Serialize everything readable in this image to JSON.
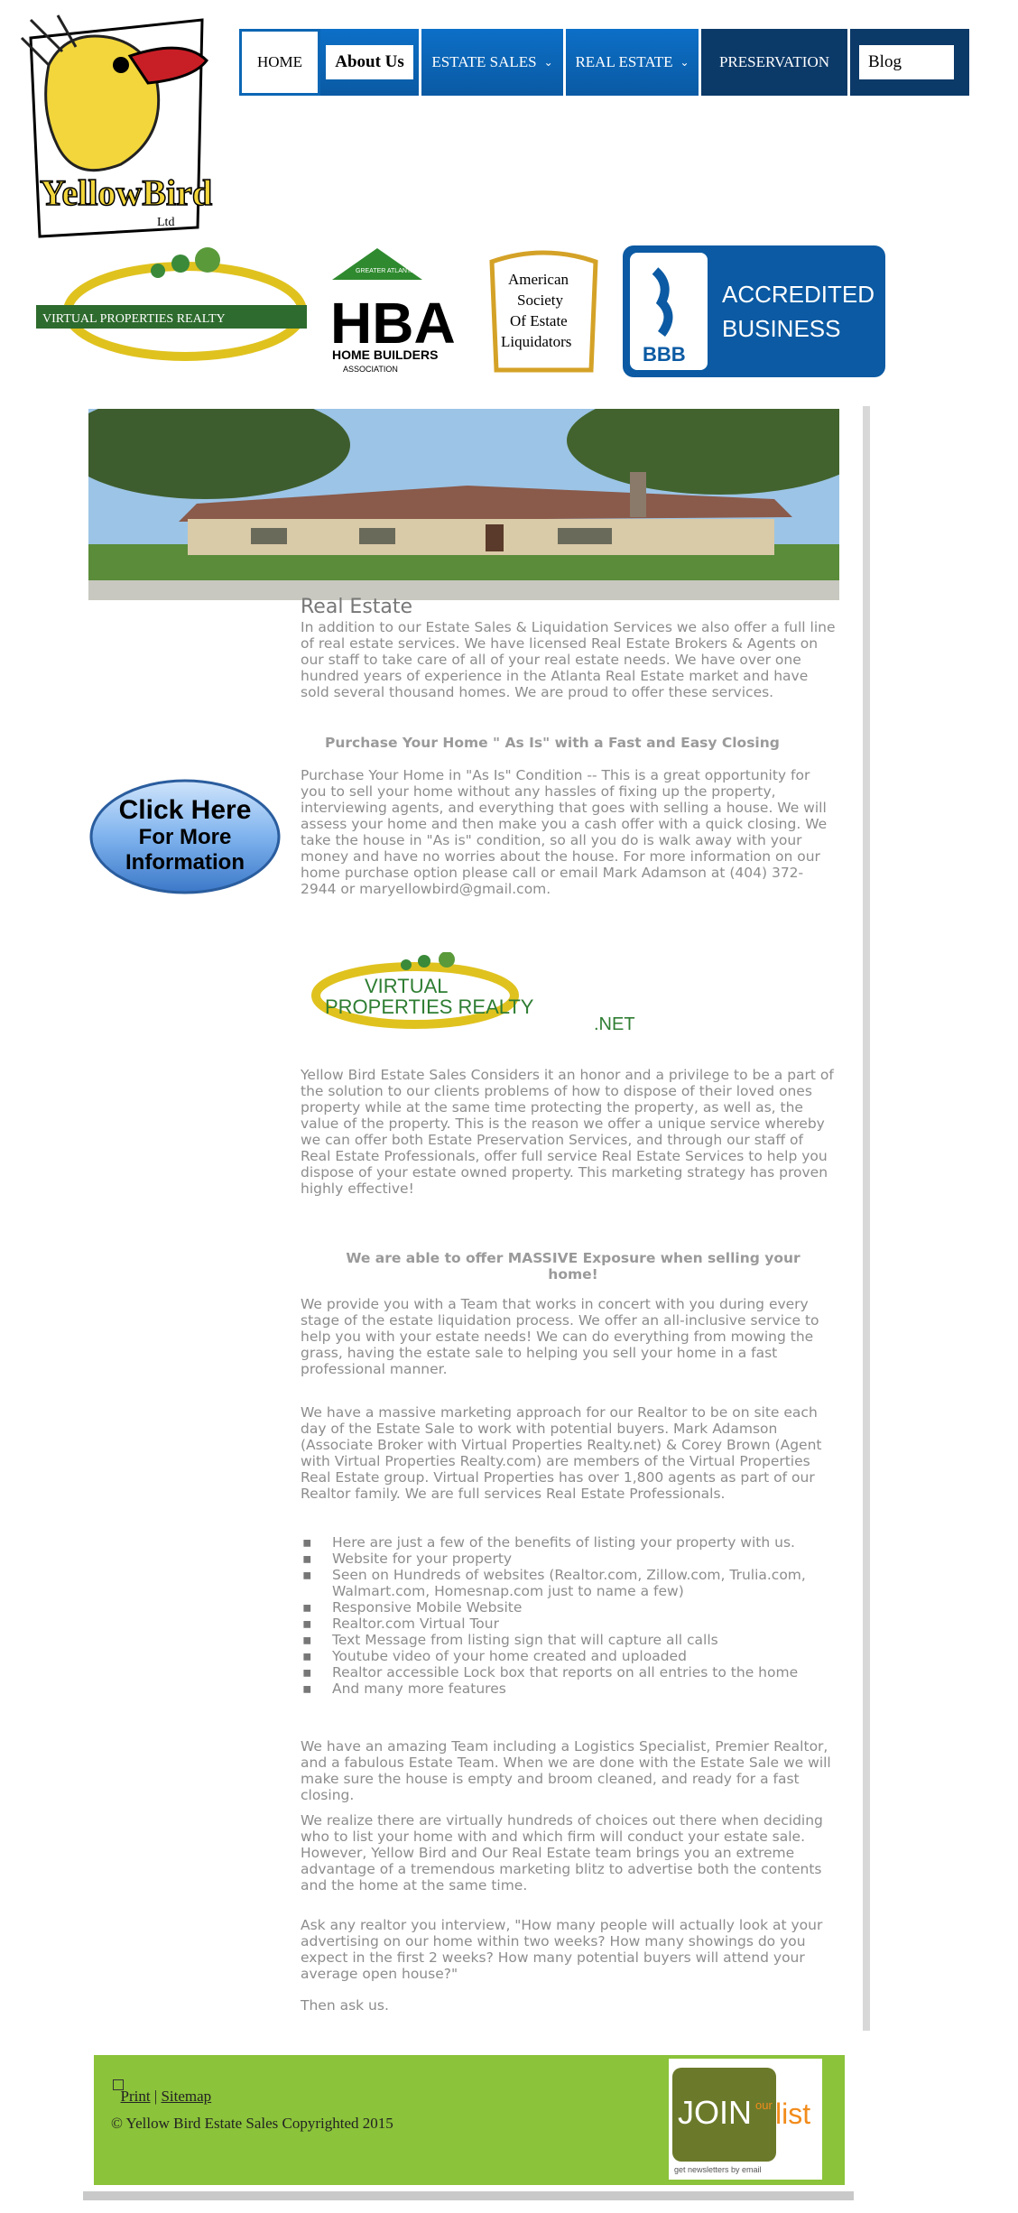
{
  "nav": {
    "items": [
      {
        "label": "HOME"
      },
      {
        "label": "About Us"
      },
      {
        "label": "ESTATE SALES"
      },
      {
        "label": "REAL ESTATE"
      },
      {
        "label": "PRESERVATION"
      },
      {
        "label": "Blog"
      }
    ]
  },
  "logo": {
    "text_main": "YellowBird",
    "text_small": "Ltd"
  },
  "badges": {
    "vpr_small": "VIRTUAL PROPERTIES REALTY",
    "hba_letters": "HBA",
    "hba_line1": "HOME BUILDERS",
    "hba_line2": "ASSOCIATION",
    "hba_top": "GREATER ATLANTA",
    "asel_line1": "American",
    "asel_line2": "Society",
    "asel_line3": "Of Estate",
    "asel_line4": "Liquidators",
    "bbb_line1": "ACCREDITED",
    "bbb_line2": "BUSINESS",
    "bbb_mark": "BBB"
  },
  "content": {
    "title": "Real Estate",
    "para1": "In addition to our Estate Sales & Liquidation Services we also offer a full line of real estate services. We have licensed Real Estate Brokers & Agents on our staff to take care of all of your real estate needs. We have over one hundred years of experience in the Atlanta Real Estate market and have sold several thousand homes. We are proud to offer these services.",
    "purchase_head": "Purchase Your Home \" As Is\" with a Fast and Easy Closing",
    "para2": "Purchase Your Home in \"As Is\" Condition -- This is a great opportunity for you to sell your home without any hassles of fixing up the property, interviewing agents, and everything that goes with selling a house. We will assess your home and then make you a cash offer with a quick closing. We take the house in \"As is\" condition, so all you do is walk away with your money and have no worries about the house. For more information on our home purchase option please call or email Mark Adamson at (404) 372-2944 or maryellowbird@gmail.com.",
    "cta_line1": "Click Here",
    "cta_line2": "For More",
    "cta_line3": "Information",
    "vpr_line1": "VIRTUAL",
    "vpr_line2": "PROPERTIES REALTY",
    "vpr_line3": ".NET",
    "para3": "Yellow Bird Estate Sales Considers it an honor and a privilege to be a part of the solution to our clients problems of how to dispose of their loved ones property while at the same time protecting the property, as well as, the value of the property. This is the reason we offer a unique service whereby we can offer both Estate Preservation Services, and through our staff of Real Estate Professionals, offer full service Real Estate Services to help you dispose of your estate owned property. This marketing strategy has proven highly effective!",
    "massive": "We are able to offer MASSIVE Exposure when selling your home!",
    "para4": "We provide you with a Team that works in concert with you during every stage of the estate liquidation process. We offer an all-inclusive service to help you with your estate needs! We can do everything from mowing the grass, having the estate sale to helping you sell your home in a fast professional manner.",
    "para5": "We have a massive marketing approach for our Realtor to be on site each day of the Estate Sale to work with potential buyers. Mark Adamson (Associate Broker with Virtual Properties Realty.net) & Corey Brown (Agent with Virtual Properties Realty.com) are members of the Virtual Properties Real Estate group. Virtual Properties has over 1,800 agents as part of our Realtor family. We are full services Real Estate Professionals.",
    "bullets": [
      "Here are just a few of the benefits of listing your property with us.",
      "Website for your property",
      "Seen on Hundreds of websites (Realtor.com, Zillow.com, Trulia.com, Walmart.com, Homesnap.com just to name a few)",
      "Responsive Mobile Website",
      "Realtor.com Virtual Tour",
      "Text Message from listing sign that will capture all calls",
      "Youtube video of your home created and uploaded",
      "Realtor accessible Lock box that reports on all entries to the home",
      "And many more features"
    ],
    "para6": "We have an amazing Team including a Logistics Specialist, Premier Realtor, and a fabulous Estate Team. When we are done with the Estate Sale we will make sure the house is empty and broom cleaned, and ready for a fast closing.",
    "para7": "We realize there are virtually hundreds of choices out there when deciding who to list your home with and which firm will conduct your estate sale. However, Yellow Bird and Our Real Estate team brings you an extreme advantage of a tremendous marketing blitz to advertise both the contents and the home at the same time.",
    "para8": "Ask any realtor you interview, \"How many people will actually look at your advertising on our home within two weeks? How many showings do you expect in the first 2 weeks? How many potential buyers will attend your average open house?\"",
    "then_ask": "Then ask us."
  },
  "footer": {
    "print": "Print",
    "sep": "|",
    "sitemap": "Sitemap",
    "copyright": "© Yellow Bird Estate Sales Copyrighted 2015",
    "join_word": "JOIN",
    "join_our": "our",
    "join_list": "list",
    "join_small": "get newsletters by email"
  },
  "colors": {
    "nav_blue": "#0c6fc7",
    "nav_dark": "#0b3968",
    "footer_green": "#8bc33a",
    "bbb_blue": "#0b5aa3"
  }
}
